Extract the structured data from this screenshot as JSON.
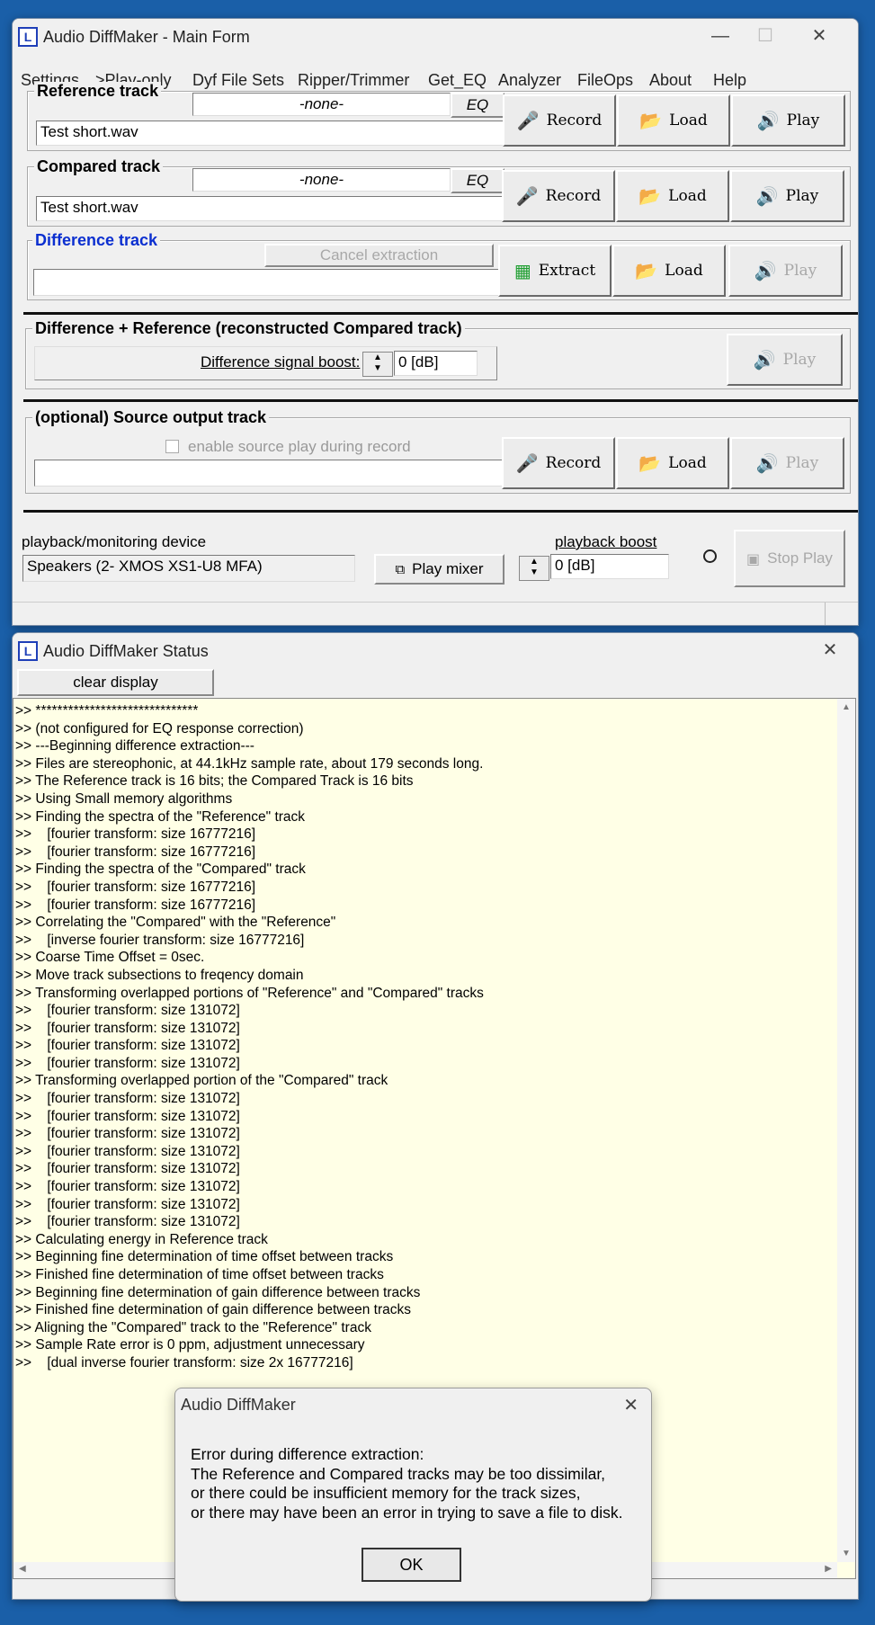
{
  "main_window": {
    "title": "Audio DiffMaker - Main Form",
    "icon_letter": "L",
    "menu": [
      "Settings",
      ">Play-only",
      "Dyf File Sets",
      "Ripper/Trimmer",
      "Get_EQ",
      "Analyzer",
      "FileOps",
      "About",
      "Help"
    ],
    "reference": {
      "label": "Reference track",
      "eq_value": "-none-",
      "eq_button": "EQ",
      "file": "Test short.wav",
      "record": "Record",
      "load": "Load",
      "play": "Play"
    },
    "compared": {
      "label": "Compared track",
      "eq_value": "-none-",
      "eq_button": "EQ",
      "file": "Test short.wav",
      "record": "Record",
      "load": "Load",
      "play": "Play"
    },
    "difference": {
      "label": "Difference track",
      "cancel": "Cancel extraction",
      "file": "",
      "extract": "Extract",
      "load": "Load",
      "play": "Play",
      "label_color": "#0b2fd0"
    },
    "diff_ref": {
      "label": "Difference + Reference   (reconstructed Compared track)",
      "boost_label": "Difference signal boost:",
      "boost_value": "0 [dB]",
      "play": "Play"
    },
    "source": {
      "label": "(optional) Source output track",
      "checkbox_label": "enable source play during record",
      "file": "",
      "record": "Record",
      "load": "Load",
      "play": "Play"
    },
    "playback": {
      "device_label": "playback/monitoring device",
      "device_value": "Speakers (2- XMOS XS1-U8 MFA)",
      "mixer_button": "Play mixer",
      "boost_label": "playback boost",
      "boost_value": "0 [dB]",
      "stop": "Stop Play"
    }
  },
  "status_window": {
    "title": "Audio DiffMaker Status",
    "clear_button": "clear display",
    "log": [
      ">> ******************************",
      ">> (not configured for EQ response correction)",
      ">> ---Beginning difference extraction---",
      ">> Files are stereophonic, at 44.1kHz sample rate, about 179 seconds long.",
      ">> The Reference track is 16 bits; the Compared Track is 16 bits",
      ">> Using Small memory algorithms",
      ">> Finding the spectra of the \"Reference\" track",
      ">>    [fourier transform: size 16777216]",
      ">>    [fourier transform: size 16777216]",
      ">> Finding the spectra of the \"Compared\" track",
      ">>    [fourier transform: size 16777216]",
      ">>    [fourier transform: size 16777216]",
      ">> Correlating the \"Compared\" with the \"Reference\"",
      ">>    [inverse fourier transform: size 16777216]",
      ">> Coarse Time Offset = 0sec.",
      ">> Move track subsections to freqency domain",
      ">> Transforming overlapped portions of \"Reference\" and \"Compared\" tracks",
      ">>    [fourier transform: size 131072]",
      ">>    [fourier transform: size 131072]",
      ">>    [fourier transform: size 131072]",
      ">>    [fourier transform: size 131072]",
      ">> Transforming overlapped portion of the \"Compared\" track",
      ">>    [fourier transform: size 131072]",
      ">>    [fourier transform: size 131072]",
      ">>    [fourier transform: size 131072]",
      ">>    [fourier transform: size 131072]",
      ">>    [fourier transform: size 131072]",
      ">>    [fourier transform: size 131072]",
      ">>    [fourier transform: size 131072]",
      ">>    [fourier transform: size 131072]",
      ">> Calculating energy in Reference track",
      ">> Beginning fine determination of time offset between tracks",
      ">> Finished fine determination of time offset between tracks",
      ">> Beginning fine determination of gain difference between tracks",
      ">> Finished fine determination of gain difference between tracks",
      ">> Aligning the \"Compared\" track to the \"Reference\" track",
      ">> Sample Rate error is 0 ppm, adjustment unnecessary",
      ">>    [dual inverse fourier transform: size 2x 16777216]"
    ],
    "log_bg": "#ffffe6"
  },
  "dialog": {
    "title": "Audio DiffMaker",
    "lines": [
      "Error during difference extraction:",
      "The Reference and Compared tracks may be too dissimilar,",
      "or there could be insufficient memory for the track sizes,",
      "or there may have been an error in trying to save a file to disk."
    ],
    "ok": "OK"
  },
  "icons": {
    "close": "✕",
    "minimize": "—",
    "maximize": "☐",
    "mic": "🎤",
    "folder": "📂",
    "speaker": "🔊",
    "calculator": "▦",
    "mixer": "⧉",
    "stop": "▣"
  },
  "colors": {
    "desktop": "#1a5fa8",
    "window": "#f0f0f0",
    "log_bg": "#ffffe6"
  }
}
